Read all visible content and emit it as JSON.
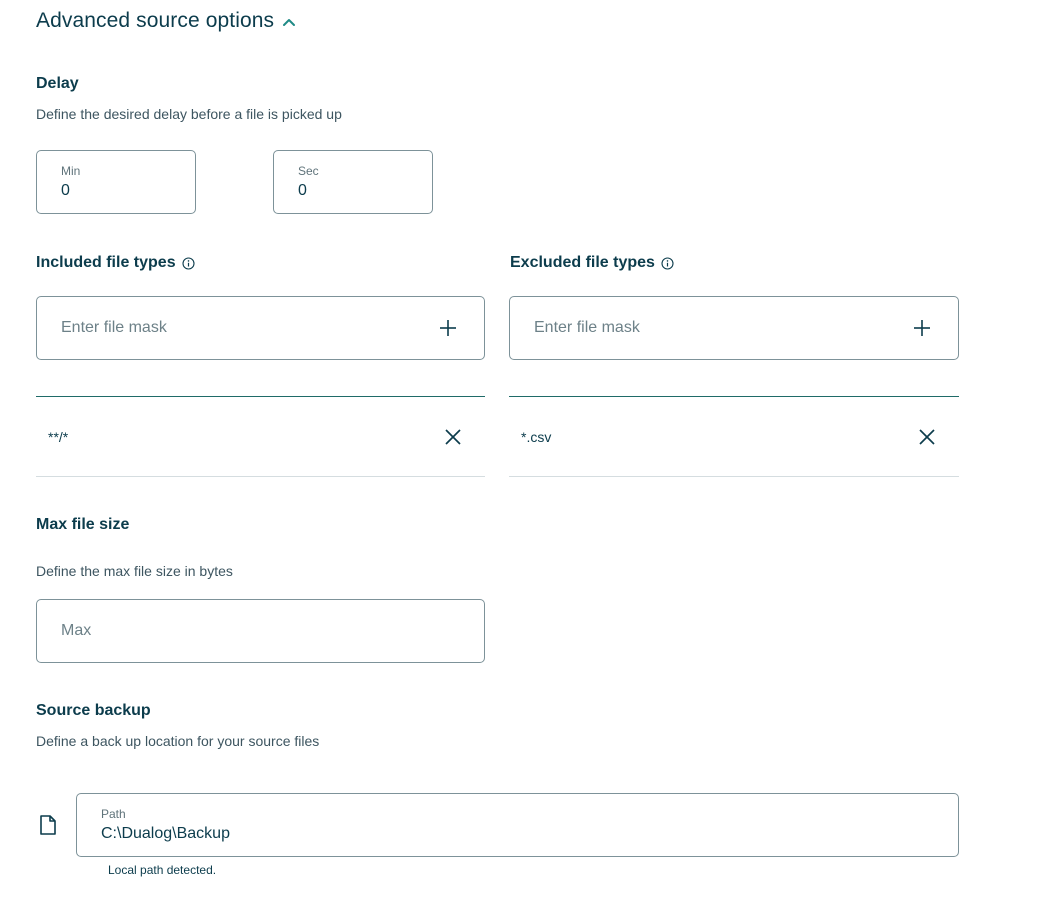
{
  "section": {
    "title": "Advanced source options",
    "chevron_icon": "chevron-up-icon"
  },
  "delay": {
    "heading": "Delay",
    "description": "Define the desired delay before a file is picked up",
    "min_label": "Min",
    "min_value": "0",
    "sec_label": "Sec",
    "sec_value": "0"
  },
  "included": {
    "heading": "Included file types",
    "placeholder": "Enter file mask",
    "items": [
      "**/*"
    ]
  },
  "excluded": {
    "heading": "Excluded file types",
    "placeholder": "Enter file mask",
    "items": [
      "*.csv"
    ]
  },
  "max_size": {
    "heading": "Max file size",
    "description": "Define the max file size in bytes",
    "placeholder": "Max"
  },
  "backup": {
    "heading": "Source backup",
    "description": "Define a back up location for your source files",
    "path_label": "Path",
    "path_value": "C:\\Dualog\\Backup",
    "hint": "Local path detected."
  },
  "colors": {
    "text": "#0c3c4c",
    "accent": "#1f6b68",
    "border": "#7d9299"
  }
}
